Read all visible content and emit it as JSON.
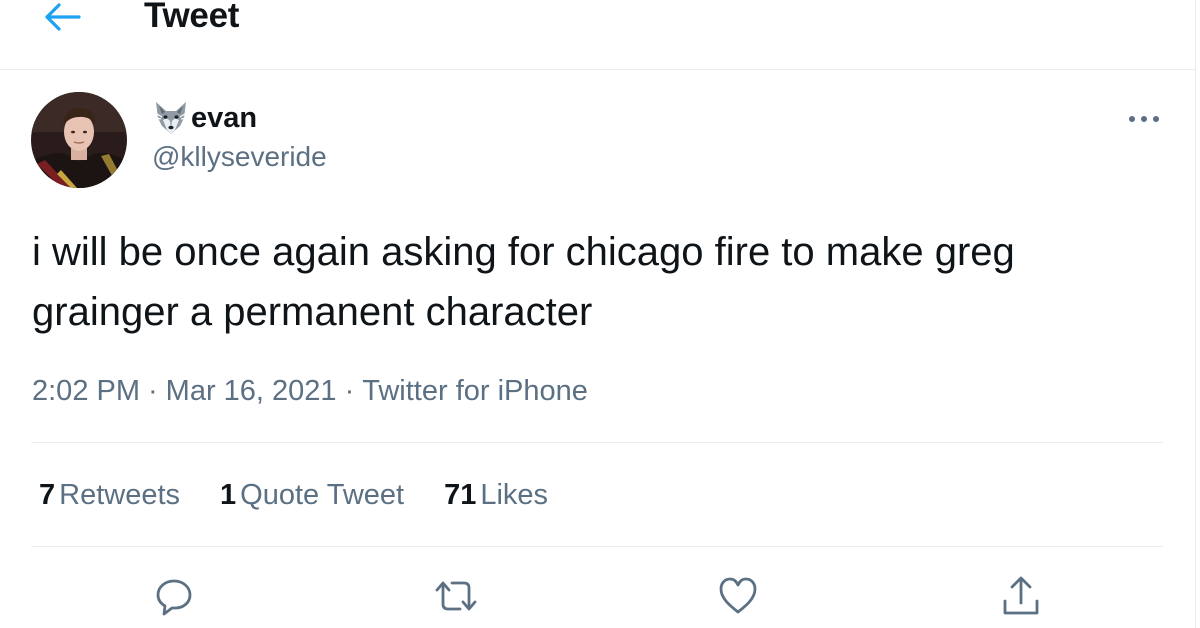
{
  "header": {
    "title": "Tweet",
    "back_icon": "arrow-left-icon",
    "accent_color": "#1da1f2"
  },
  "author": {
    "emoji_icon": "wolf-face-icon",
    "display_name": "evan",
    "handle": "@kllyseveride",
    "avatar_icon": "user-avatar"
  },
  "more_icon": "ellipsis-icon",
  "tweet": {
    "text": "i will be once again asking for chicago fire to make greg grainger a permanent character",
    "time": "2:02 PM",
    "date": "Mar 16, 2021",
    "separator": "·",
    "source": "Twitter for iPhone"
  },
  "stats": {
    "retweets": {
      "count": "7",
      "label": "Retweets"
    },
    "quotes": {
      "count": "1",
      "label": "Quote Tweet"
    },
    "likes": {
      "count": "71",
      "label": "Likes"
    }
  },
  "actions": [
    {
      "name": "reply",
      "icon": "reply-icon"
    },
    {
      "name": "retweet",
      "icon": "retweet-icon"
    },
    {
      "name": "like",
      "icon": "heart-icon"
    },
    {
      "name": "share",
      "icon": "share-icon"
    }
  ],
  "colors": {
    "text_primary": "#0f1419",
    "text_secondary": "#5b7083",
    "border": "#e6ecf0",
    "accent": "#1da1f2"
  }
}
